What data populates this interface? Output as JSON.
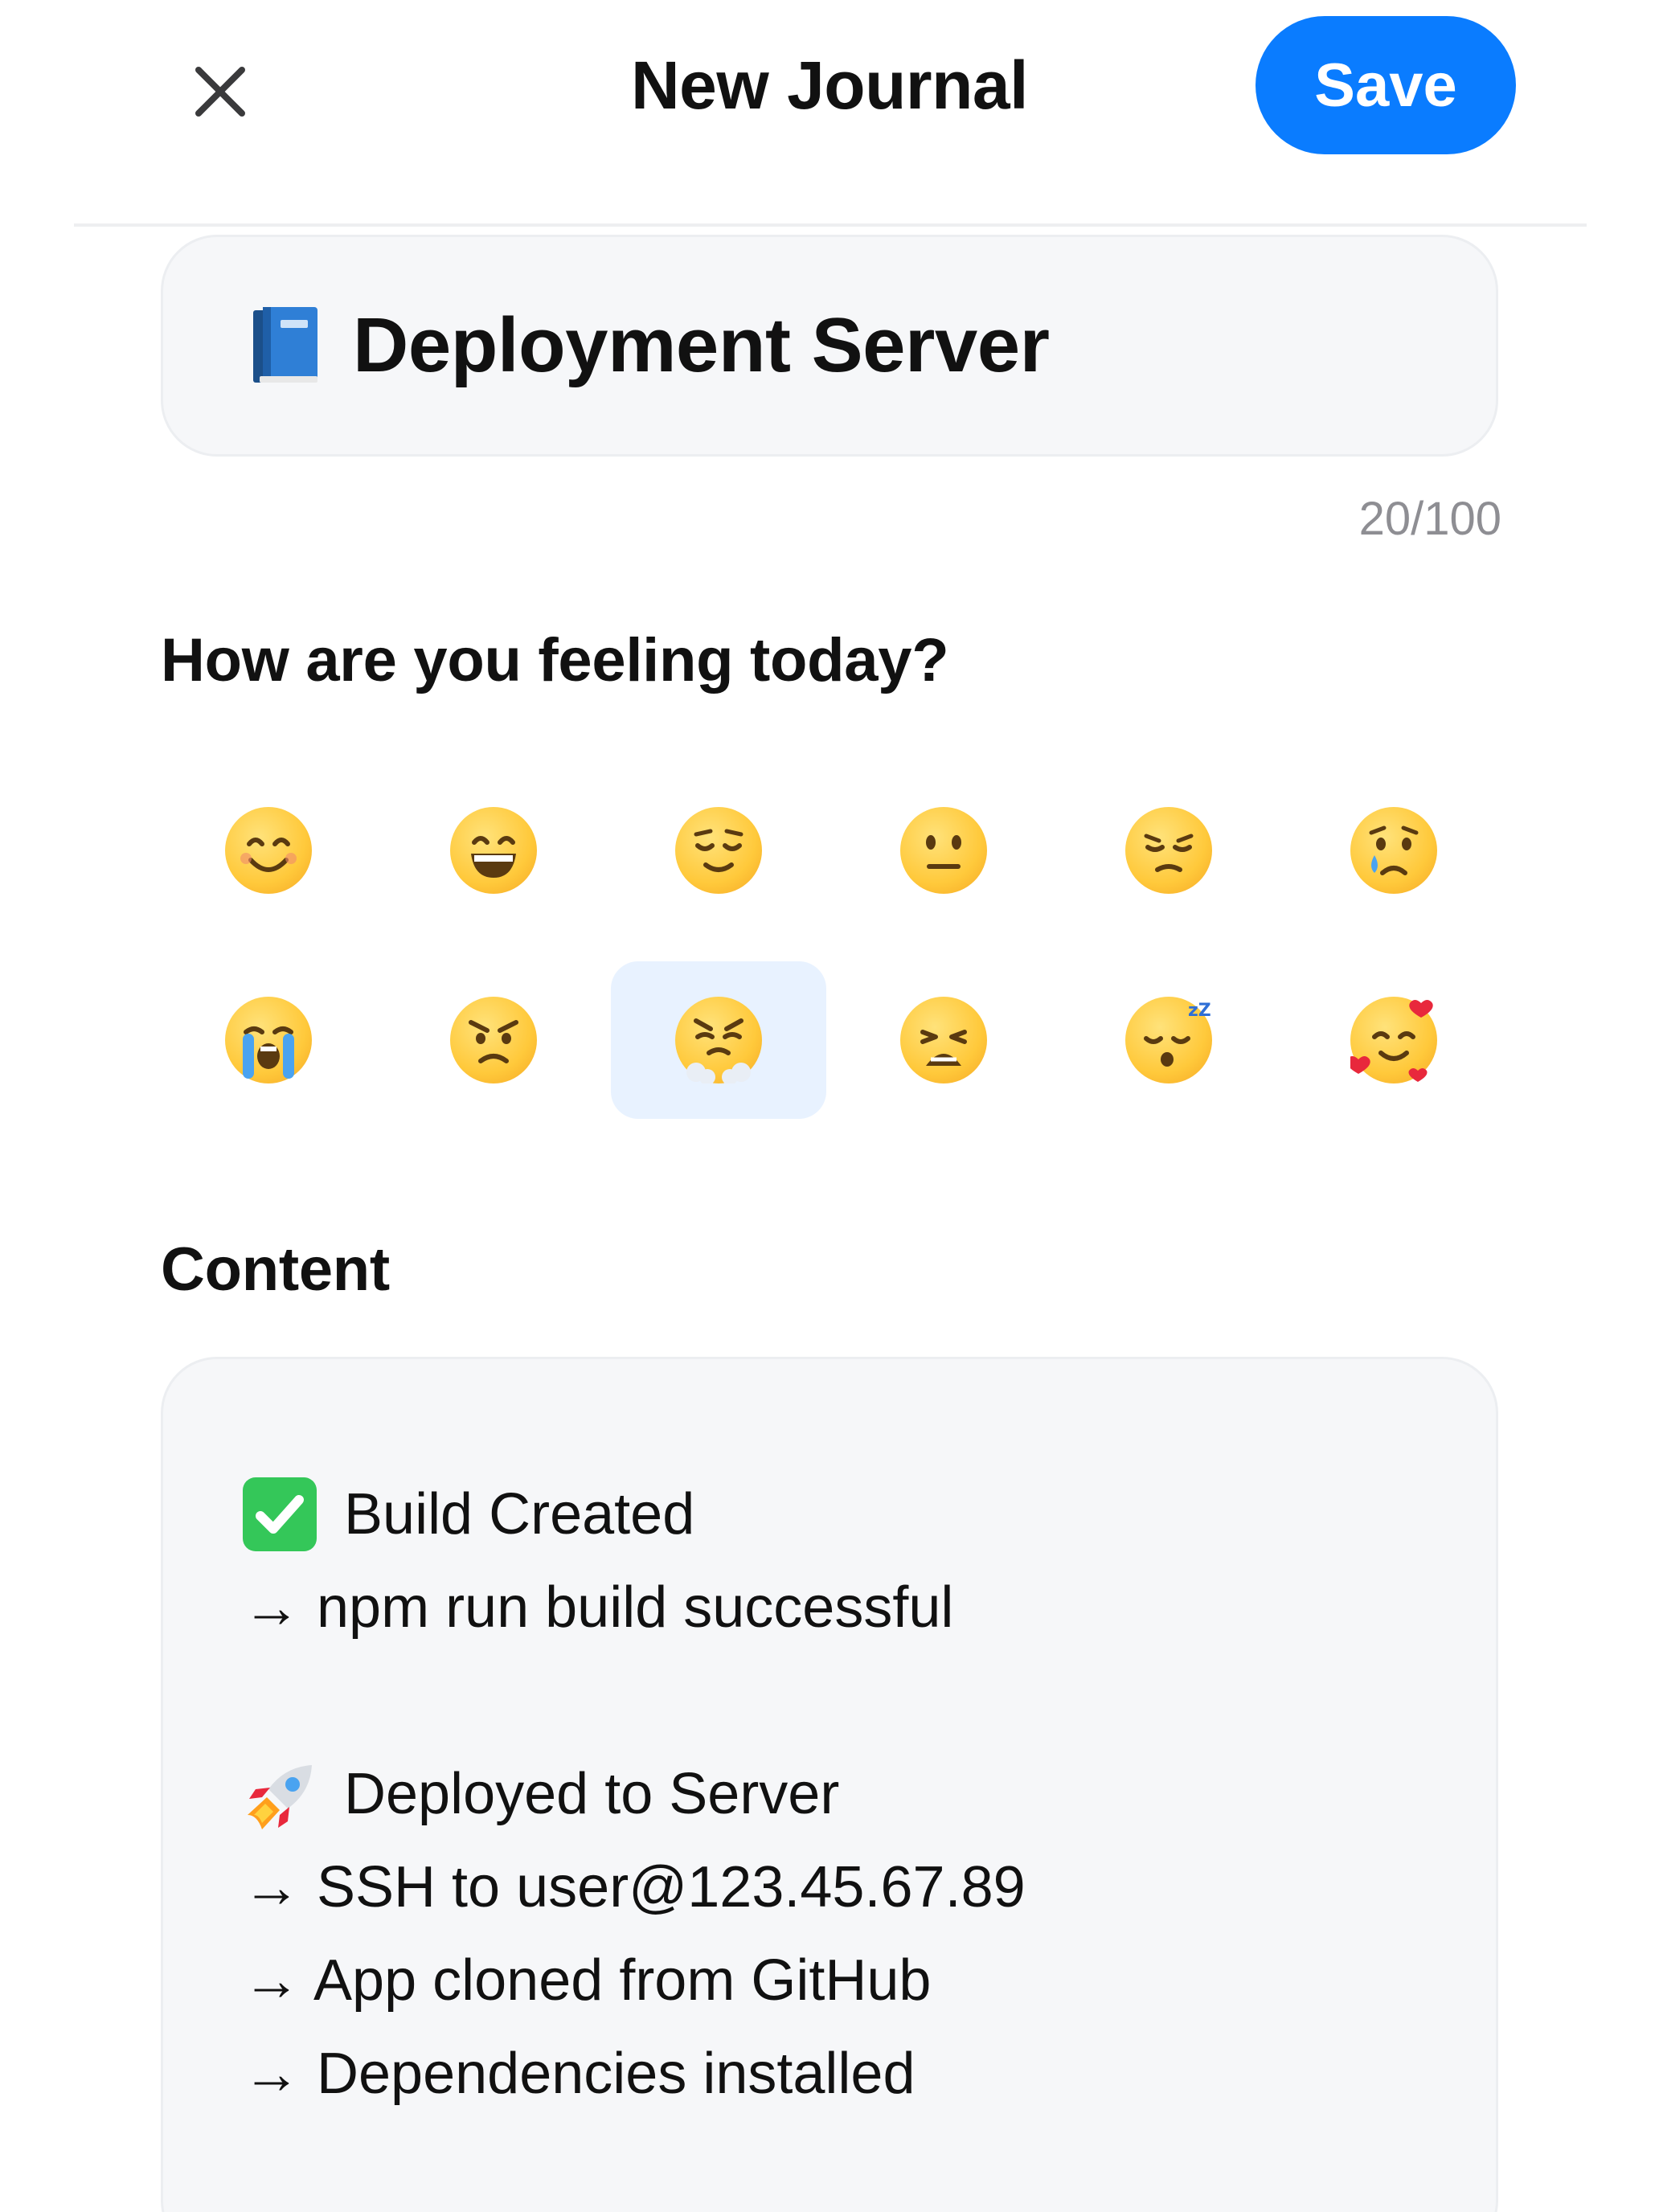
{
  "header": {
    "title": "New Journal",
    "save_label": "Save"
  },
  "entry": {
    "title_value": "Deployment Server",
    "title_icon": "blue-book-icon",
    "char_count": "20/100"
  },
  "mood": {
    "label": "How are you feeling today?",
    "selected_index": 8,
    "options": [
      {
        "name": "smiling-face-icon"
      },
      {
        "name": "grinning-face-icon"
      },
      {
        "name": "relieved-face-icon"
      },
      {
        "name": "neutral-face-icon"
      },
      {
        "name": "pensive-face-icon"
      },
      {
        "name": "crying-face-icon"
      },
      {
        "name": "loudly-crying-face-icon"
      },
      {
        "name": "angry-face-icon"
      },
      {
        "name": "steam-from-nose-face-icon"
      },
      {
        "name": "weary-face-icon"
      },
      {
        "name": "sleeping-face-icon"
      },
      {
        "name": "smiling-face-with-hearts-icon"
      }
    ]
  },
  "content": {
    "label": "Content",
    "lines": [
      "Build Created",
      "→ npm run build successful",
      "Deployed to Server",
      "→ SSH to user@123.45.67.89",
      "→ App cloned from GitHub",
      "→ Dependencies installed"
    ]
  },
  "colors": {
    "accent": "#0a7cff",
    "selected_mood_bg": "#e8f2ff",
    "card_bg": "#f6f7f9",
    "check_green": "#34c759"
  }
}
